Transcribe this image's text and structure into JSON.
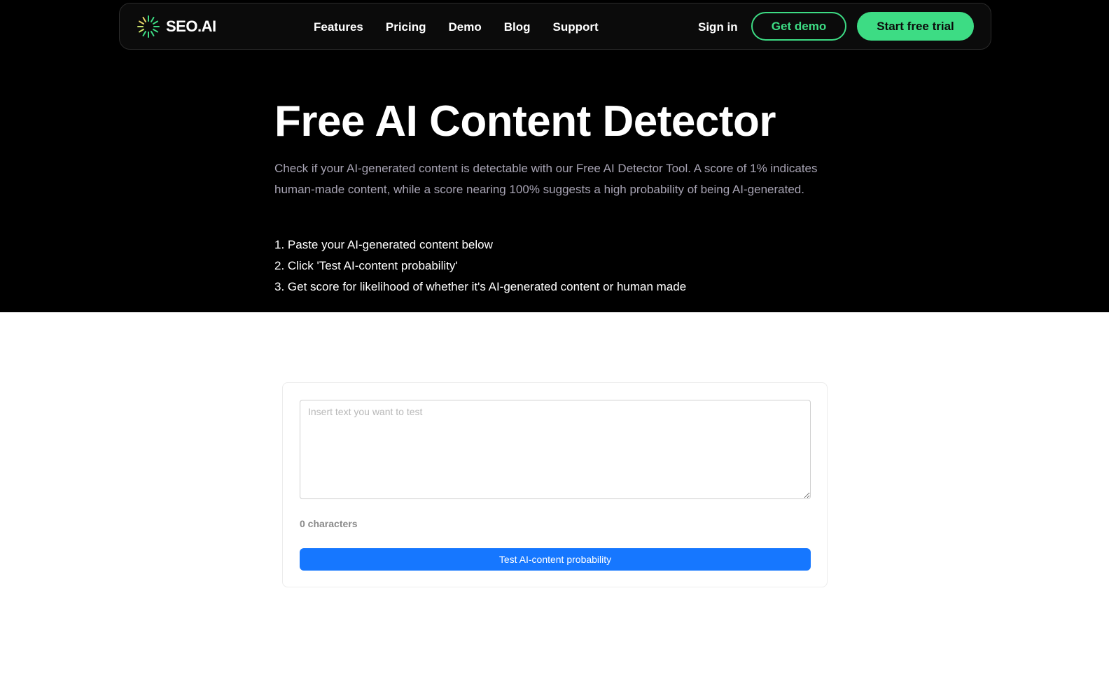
{
  "header": {
    "logo_text": "SEO.AI",
    "nav": [
      {
        "label": "Features"
      },
      {
        "label": "Pricing"
      },
      {
        "label": "Demo"
      },
      {
        "label": "Blog"
      },
      {
        "label": "Support"
      }
    ],
    "sign_in": "Sign in",
    "get_demo": "Get demo",
    "start_trial": "Start free trial"
  },
  "hero": {
    "title": "Free AI Content Detector",
    "intro": "Check if your AI-generated content is detectable with our Free AI Detector Tool. A score of 1% indicates human-made content, while a score nearing 100% suggests a high probability of being AI-generated.",
    "steps": [
      "1. Paste your AI-generated content below",
      "2. Click 'Test AI-content probability'",
      "3. Get score for likelihood of whether it's AI-generated content or human made"
    ]
  },
  "tool": {
    "placeholder": "Insert text you want to test",
    "value": "",
    "char_count": "0 characters",
    "button_label": "Test AI-content probability"
  },
  "colors": {
    "accent_green": "#3ddc84",
    "primary_blue": "#1677ff",
    "hero_bg": "#000000"
  },
  "icons": {
    "logo": "sunburst-logo-icon"
  }
}
